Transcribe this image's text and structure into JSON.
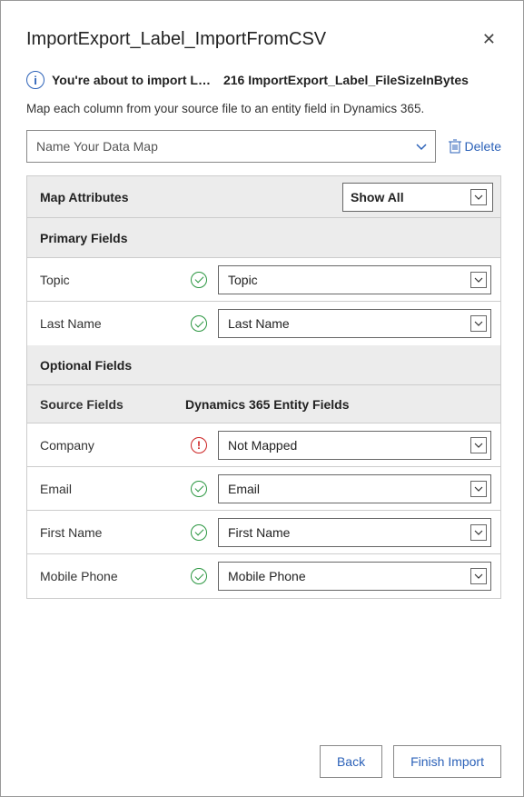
{
  "title": "ImportExport_Label_ImportFromCSV",
  "info_main": "You're about to import L…",
  "info_sub": "216 ImportExport_Label_FileSizeInBytes",
  "description": "Map each column from your source file to an entity field in Dynamics 365.",
  "map_name_placeholder": "Name Your Data Map",
  "delete_label": "Delete",
  "map_attributes_label": "Map Attributes",
  "show_all_label": "Show All",
  "primary_fields_label": "Primary Fields",
  "optional_fields_label": "Optional Fields",
  "source_fields_label": "Source Fields",
  "entity_fields_label": "Dynamics 365 Entity Fields",
  "primary_rows": [
    {
      "source": "Topic",
      "status": "ok",
      "mapped": "Topic"
    },
    {
      "source": "Last Name",
      "status": "ok",
      "mapped": "Last Name"
    }
  ],
  "optional_rows": [
    {
      "source": "Company",
      "status": "error",
      "mapped": "Not Mapped"
    },
    {
      "source": "Email",
      "status": "ok",
      "mapped": "Email"
    },
    {
      "source": "First Name",
      "status": "ok",
      "mapped": "First Name"
    },
    {
      "source": "Mobile Phone",
      "status": "ok",
      "mapped": "Mobile Phone"
    }
  ],
  "back_label": "Back",
  "finish_label": "Finish Import"
}
